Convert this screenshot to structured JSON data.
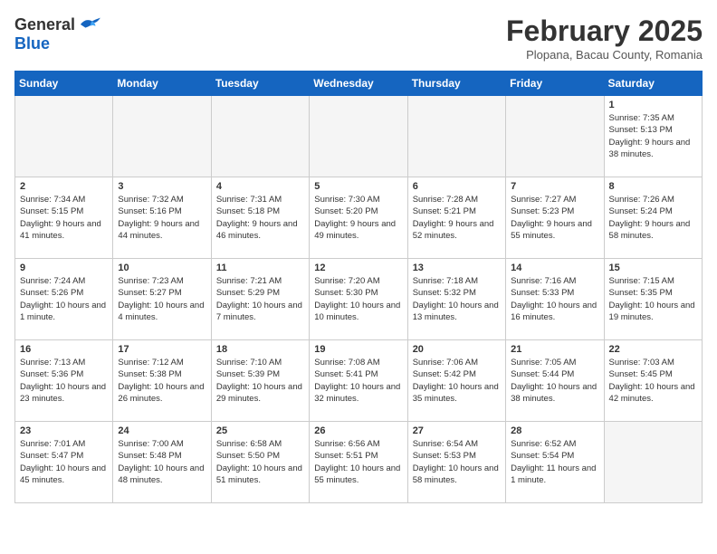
{
  "header": {
    "logo_general": "General",
    "logo_blue": "Blue",
    "month_title": "February 2025",
    "subtitle": "Plopana, Bacau County, Romania"
  },
  "calendar": {
    "days_of_week": [
      "Sunday",
      "Monday",
      "Tuesday",
      "Wednesday",
      "Thursday",
      "Friday",
      "Saturday"
    ],
    "weeks": [
      [
        {
          "day": "",
          "info": ""
        },
        {
          "day": "",
          "info": ""
        },
        {
          "day": "",
          "info": ""
        },
        {
          "day": "",
          "info": ""
        },
        {
          "day": "",
          "info": ""
        },
        {
          "day": "",
          "info": ""
        },
        {
          "day": "1",
          "info": "Sunrise: 7:35 AM\nSunset: 5:13 PM\nDaylight: 9 hours and 38 minutes."
        }
      ],
      [
        {
          "day": "2",
          "info": "Sunrise: 7:34 AM\nSunset: 5:15 PM\nDaylight: 9 hours and 41 minutes."
        },
        {
          "day": "3",
          "info": "Sunrise: 7:32 AM\nSunset: 5:16 PM\nDaylight: 9 hours and 44 minutes."
        },
        {
          "day": "4",
          "info": "Sunrise: 7:31 AM\nSunset: 5:18 PM\nDaylight: 9 hours and 46 minutes."
        },
        {
          "day": "5",
          "info": "Sunrise: 7:30 AM\nSunset: 5:20 PM\nDaylight: 9 hours and 49 minutes."
        },
        {
          "day": "6",
          "info": "Sunrise: 7:28 AM\nSunset: 5:21 PM\nDaylight: 9 hours and 52 minutes."
        },
        {
          "day": "7",
          "info": "Sunrise: 7:27 AM\nSunset: 5:23 PM\nDaylight: 9 hours and 55 minutes."
        },
        {
          "day": "8",
          "info": "Sunrise: 7:26 AM\nSunset: 5:24 PM\nDaylight: 9 hours and 58 minutes."
        }
      ],
      [
        {
          "day": "9",
          "info": "Sunrise: 7:24 AM\nSunset: 5:26 PM\nDaylight: 10 hours and 1 minute."
        },
        {
          "day": "10",
          "info": "Sunrise: 7:23 AM\nSunset: 5:27 PM\nDaylight: 10 hours and 4 minutes."
        },
        {
          "day": "11",
          "info": "Sunrise: 7:21 AM\nSunset: 5:29 PM\nDaylight: 10 hours and 7 minutes."
        },
        {
          "day": "12",
          "info": "Sunrise: 7:20 AM\nSunset: 5:30 PM\nDaylight: 10 hours and 10 minutes."
        },
        {
          "day": "13",
          "info": "Sunrise: 7:18 AM\nSunset: 5:32 PM\nDaylight: 10 hours and 13 minutes."
        },
        {
          "day": "14",
          "info": "Sunrise: 7:16 AM\nSunset: 5:33 PM\nDaylight: 10 hours and 16 minutes."
        },
        {
          "day": "15",
          "info": "Sunrise: 7:15 AM\nSunset: 5:35 PM\nDaylight: 10 hours and 19 minutes."
        }
      ],
      [
        {
          "day": "16",
          "info": "Sunrise: 7:13 AM\nSunset: 5:36 PM\nDaylight: 10 hours and 23 minutes."
        },
        {
          "day": "17",
          "info": "Sunrise: 7:12 AM\nSunset: 5:38 PM\nDaylight: 10 hours and 26 minutes."
        },
        {
          "day": "18",
          "info": "Sunrise: 7:10 AM\nSunset: 5:39 PM\nDaylight: 10 hours and 29 minutes."
        },
        {
          "day": "19",
          "info": "Sunrise: 7:08 AM\nSunset: 5:41 PM\nDaylight: 10 hours and 32 minutes."
        },
        {
          "day": "20",
          "info": "Sunrise: 7:06 AM\nSunset: 5:42 PM\nDaylight: 10 hours and 35 minutes."
        },
        {
          "day": "21",
          "info": "Sunrise: 7:05 AM\nSunset: 5:44 PM\nDaylight: 10 hours and 38 minutes."
        },
        {
          "day": "22",
          "info": "Sunrise: 7:03 AM\nSunset: 5:45 PM\nDaylight: 10 hours and 42 minutes."
        }
      ],
      [
        {
          "day": "23",
          "info": "Sunrise: 7:01 AM\nSunset: 5:47 PM\nDaylight: 10 hours and 45 minutes."
        },
        {
          "day": "24",
          "info": "Sunrise: 7:00 AM\nSunset: 5:48 PM\nDaylight: 10 hours and 48 minutes."
        },
        {
          "day": "25",
          "info": "Sunrise: 6:58 AM\nSunset: 5:50 PM\nDaylight: 10 hours and 51 minutes."
        },
        {
          "day": "26",
          "info": "Sunrise: 6:56 AM\nSunset: 5:51 PM\nDaylight: 10 hours and 55 minutes."
        },
        {
          "day": "27",
          "info": "Sunrise: 6:54 AM\nSunset: 5:53 PM\nDaylight: 10 hours and 58 minutes."
        },
        {
          "day": "28",
          "info": "Sunrise: 6:52 AM\nSunset: 5:54 PM\nDaylight: 11 hours and 1 minute."
        },
        {
          "day": "",
          "info": ""
        }
      ]
    ]
  }
}
